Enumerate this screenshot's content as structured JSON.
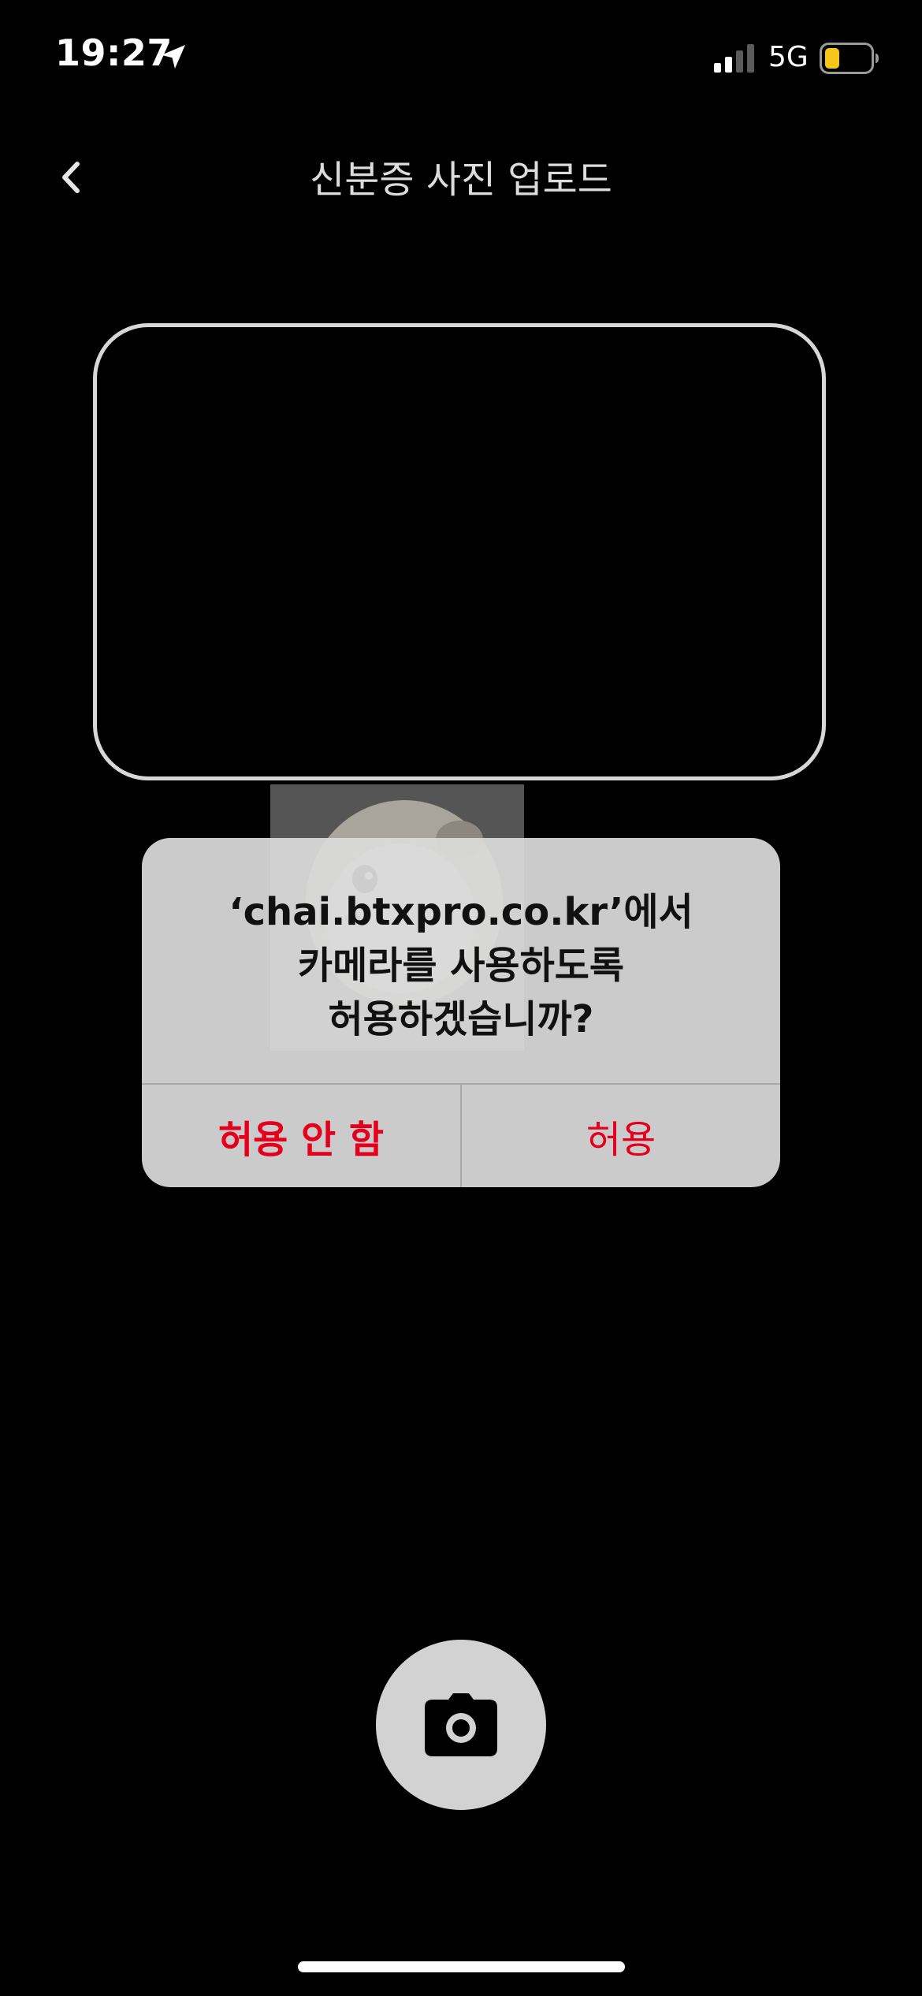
{
  "status": {
    "time": "19:27",
    "network": "5G",
    "icons": [
      "location-arrow-icon",
      "signal-icon",
      "battery-icon"
    ],
    "battery_color": "#f5c518"
  },
  "header": {
    "title": "신분증 사진 업로드",
    "back_icon": "chevron-left-icon"
  },
  "alert": {
    "lines": [
      "‘chai.btxpro.co.kr’에서",
      "카메라를 사용하도록",
      "허용하겠습니까?"
    ],
    "deny_label": "허용 안 함",
    "allow_label": "허용",
    "button_color": "#e4001c"
  },
  "camera": {
    "shutter_icon": "camera-icon"
  }
}
